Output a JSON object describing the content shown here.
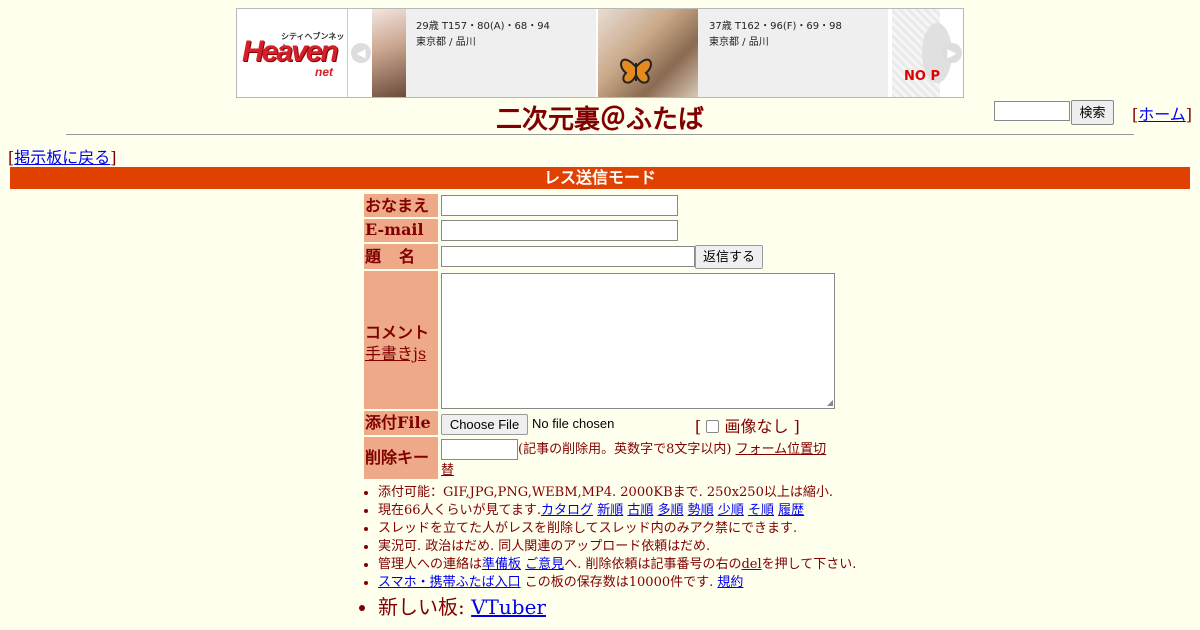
{
  "banner": {
    "logo_small": "シティヘブンネット",
    "logo_big": "Heaven",
    "logo_net": "net",
    "card1": {
      "line1": "29歳 T157・80(A)・68・94",
      "line2": "東京都 / 品川"
    },
    "card2": {
      "line1": "37歳 T162・96(F)・69・98",
      "line2": "東京都 / 品川"
    },
    "card3_text": "NO P",
    "prev_icon": "◀",
    "next_icon": "▶"
  },
  "header": {
    "title": "二次元裏＠ふたば",
    "search_button": "検索",
    "home_link": "ホーム",
    "bracket_open": "[",
    "bracket_close": "]"
  },
  "nav": {
    "back_link": "掲示板に戻る"
  },
  "mode_bar": "レス送信モード",
  "form": {
    "name_label": "おなまえ",
    "email_label": "E-mail",
    "subject_label": "題　名",
    "submit_button": "返信する",
    "comment_label": "コメント",
    "handwriting_link": "手書きjs",
    "file_label": "添付File",
    "file_button": "Choose File",
    "file_status": "No file chosen",
    "no_image_label": "画像なし",
    "delete_key_label": "削除キー",
    "delete_key_note": "(記事の削除用。英数字で8文字以内)",
    "form_position_link_1": "フォーム位置切",
    "form_position_link_2": "替"
  },
  "notes": {
    "line1": "添付可能：GIF,JPG,PNG,WEBM,MP4. 2000KBまで. 250x250以上は縮小.",
    "line2_prefix": "現在66人くらいが見てます.",
    "line2_links": [
      "カタログ",
      "新順",
      "古順",
      "多順",
      "勢順",
      "少順",
      "そ順",
      "履歴"
    ],
    "line3": "スレッドを立てた人がレスを削除してスレッド内のみアク禁にできます.",
    "line4": "実況可. 政治はだめ. 同人関連のアップロード依頼はだめ.",
    "line5_prefix": "管理人への連絡は",
    "line5_link1": "準備板",
    "line5_link2": "ご意見",
    "line5_mid": "へ. 削除依頼は記事番号の右の",
    "line5_del": "del",
    "line5_suffix": "を押して下さい.",
    "line6_link": "スマホ・携帯ふたば入口",
    "line6_mid": "この板の保存数は10000件です.",
    "line6_rules": "規約",
    "line7_prefix": "新しい板: ",
    "line7_link": "VTuber"
  }
}
